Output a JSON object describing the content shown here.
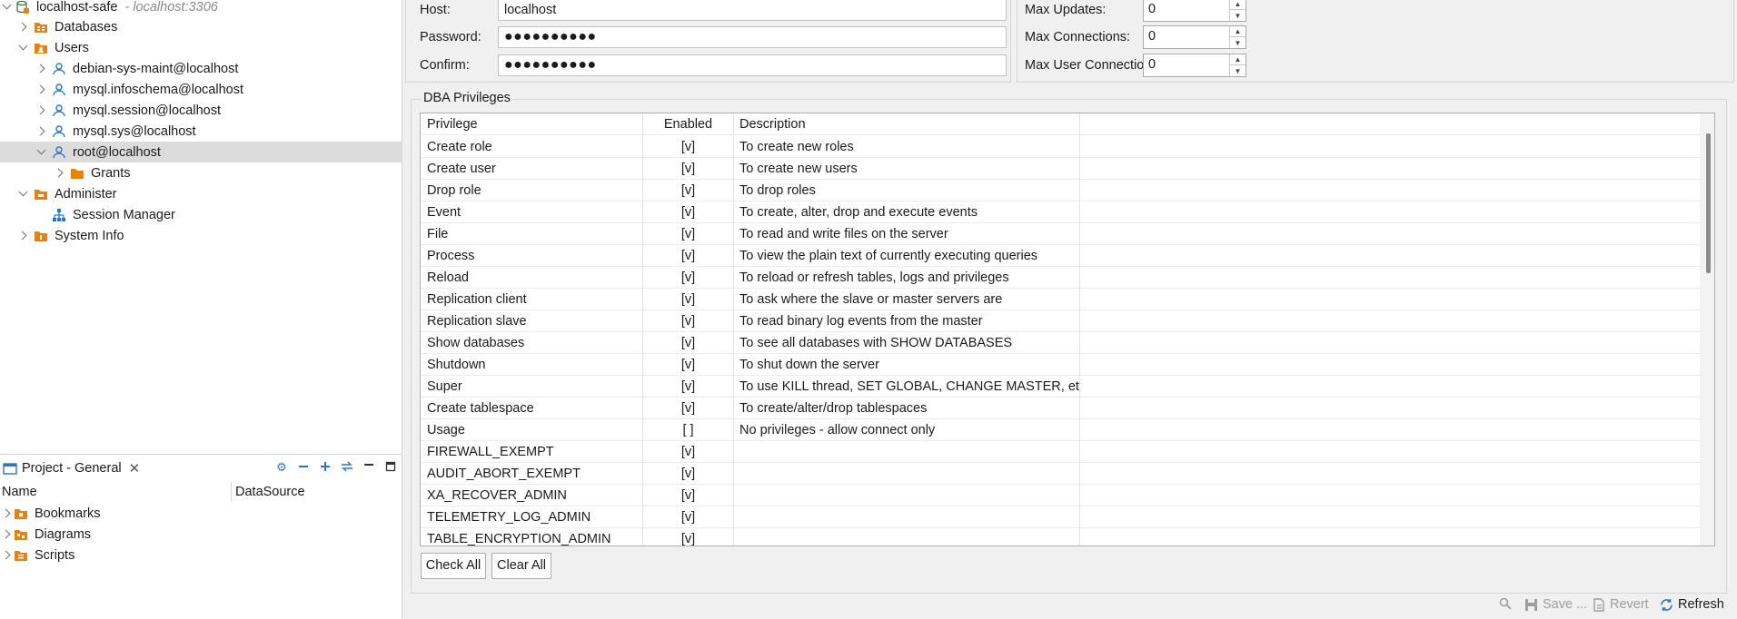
{
  "tree": {
    "connection": {
      "name": "localhost-safe",
      "subtitle": "- localhost:3306"
    },
    "items": [
      {
        "label": "Databases"
      },
      {
        "label": "Users"
      },
      {
        "label": "debian-sys-maint@localhost"
      },
      {
        "label": "mysql.infoschema@localhost"
      },
      {
        "label": "mysql.session@localhost"
      },
      {
        "label": "mysql.sys@localhost"
      },
      {
        "label": "root@localhost"
      },
      {
        "label": "Grants"
      },
      {
        "label": "Administer"
      },
      {
        "label": "Session Manager"
      },
      {
        "label": "System Info"
      }
    ]
  },
  "project": {
    "tab_title": "Project - General",
    "close_glyph": "✕",
    "columns": {
      "name": "Name",
      "datasource": "DataSource"
    },
    "items": [
      {
        "label": "Bookmarks"
      },
      {
        "label": "Diagrams"
      },
      {
        "label": "Scripts"
      }
    ]
  },
  "form": {
    "host_label": "Host:",
    "host_value": "localhost",
    "password_label": "Password:",
    "password_value": "●●●●●●●●●●",
    "confirm_label": "Confirm:",
    "confirm_value": "●●●●●●●●●●",
    "max_updates_label": "Max Updates:",
    "max_updates_value": "0",
    "max_connections_label": "Max Connections:",
    "max_connections_value": "0",
    "max_user_connections_label": "Max User Connections:",
    "max_user_connections_value": "0"
  },
  "dba": {
    "title": "DBA Privileges",
    "columns": {
      "privilege": "Privilege",
      "enabled": "Enabled",
      "description": "Description"
    },
    "rows": [
      {
        "privilege": "Create role",
        "enabled": "[v]",
        "description": "To create new roles"
      },
      {
        "privilege": "Create user",
        "enabled": "[v]",
        "description": "To create new users"
      },
      {
        "privilege": "Drop role",
        "enabled": "[v]",
        "description": "To drop roles"
      },
      {
        "privilege": "Event",
        "enabled": "[v]",
        "description": "To create, alter, drop and execute events"
      },
      {
        "privilege": "File",
        "enabled": "[v]",
        "description": "To read and write files on the server"
      },
      {
        "privilege": "Process",
        "enabled": "[v]",
        "description": "To view the plain text of currently executing queries"
      },
      {
        "privilege": "Reload",
        "enabled": "[v]",
        "description": "To reload or refresh tables, logs and privileges"
      },
      {
        "privilege": "Replication client",
        "enabled": "[v]",
        "description": "To ask where the slave or master servers are"
      },
      {
        "privilege": "Replication slave",
        "enabled": "[v]",
        "description": "To read binary log events from the master"
      },
      {
        "privilege": "Show databases",
        "enabled": "[v]",
        "description": "To see all databases with SHOW DATABASES"
      },
      {
        "privilege": "Shutdown",
        "enabled": "[v]",
        "description": "To shut down the server"
      },
      {
        "privilege": "Super",
        "enabled": "[v]",
        "description": "To use KILL thread, SET GLOBAL, CHANGE MASTER, etc."
      },
      {
        "privilege": "Create tablespace",
        "enabled": "[v]",
        "description": "To create/alter/drop tablespaces"
      },
      {
        "privilege": "Usage",
        "enabled": "[ ]",
        "description": "No privileges - allow connect only"
      },
      {
        "privilege": "FIREWALL_EXEMPT",
        "enabled": "[v]",
        "description": ""
      },
      {
        "privilege": "AUDIT_ABORT_EXEMPT",
        "enabled": "[v]",
        "description": ""
      },
      {
        "privilege": "XA_RECOVER_ADMIN",
        "enabled": "[v]",
        "description": ""
      },
      {
        "privilege": "TELEMETRY_LOG_ADMIN",
        "enabled": "[v]",
        "description": ""
      },
      {
        "privilege": "TABLE_ENCRYPTION_ADMIN",
        "enabled": "[v]",
        "description": ""
      }
    ]
  },
  "buttons": {
    "check_all": "Check All",
    "clear_all": "Clear All"
  },
  "bottom": {
    "save": "Save ...",
    "revert": "Revert",
    "refresh": "Refresh"
  },
  "colors": {
    "accent": "#2a77c9",
    "folder": "#e8820e",
    "selection": "#dcdcdc"
  }
}
